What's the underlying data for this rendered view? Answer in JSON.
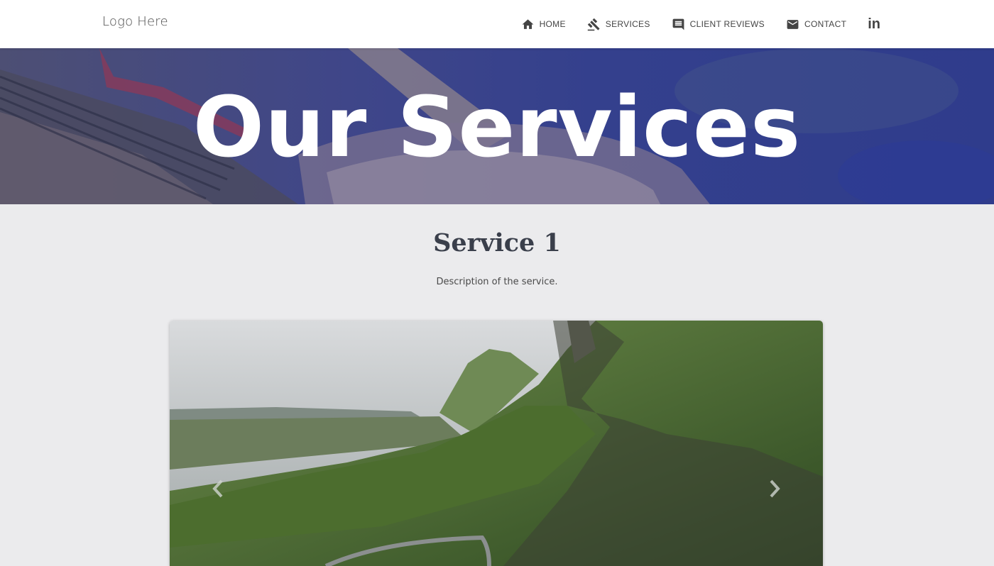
{
  "nav": {
    "logo": "Logo Here",
    "items": [
      {
        "label": "HOME",
        "icon": "home-icon"
      },
      {
        "label": "SERVICES",
        "icon": "gavel-icon"
      },
      {
        "label": "CLIENT REVIEWS",
        "icon": "comment-icon"
      },
      {
        "label": "CONTACT",
        "icon": "mail-icon"
      }
    ],
    "social_icon": "linkedin-icon",
    "social_text": "in"
  },
  "hero": {
    "title": "Our Services"
  },
  "service": {
    "title": "Service 1",
    "description": "Description of the service.",
    "carousel": {
      "prev_icon": "chevron-left-icon",
      "next_icon": "chevron-right-icon"
    }
  },
  "colors": {
    "hero_overlay": "#34408d",
    "page_bg": "#ebebed",
    "heading": "#3a3f4b"
  }
}
